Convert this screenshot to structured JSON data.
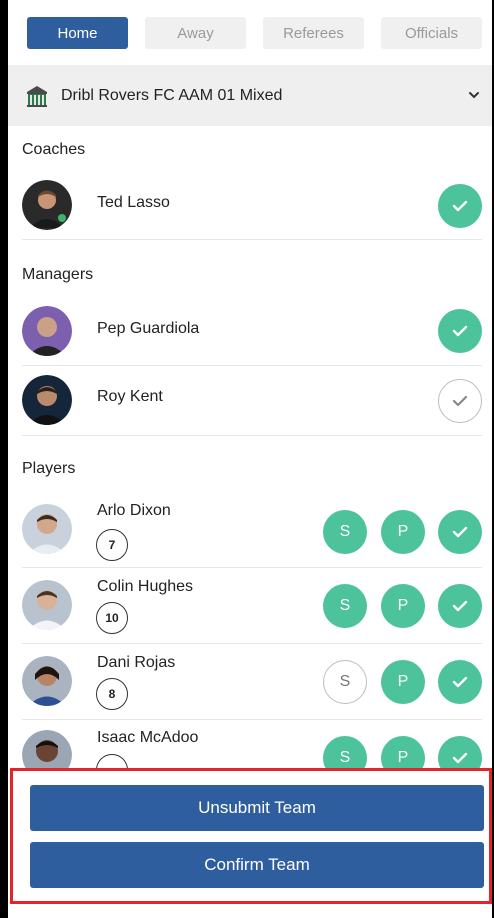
{
  "tabs": [
    {
      "label": "Home",
      "active": true
    },
    {
      "label": "Away",
      "active": false
    },
    {
      "label": "Referees",
      "active": false
    },
    {
      "label": "Officials",
      "active": false
    }
  ],
  "team": {
    "name": "Dribl Rovers FC AAM 01 Mixed",
    "icon": "club-crest-icon"
  },
  "sections": {
    "coaches": "Coaches",
    "managers": "Managers",
    "players": "Players"
  },
  "coaches": [
    {
      "name": "Ted Lasso",
      "checked": true
    }
  ],
  "managers": [
    {
      "name": "Pep Guardiola",
      "checked": true
    },
    {
      "name": "Roy Kent",
      "checked": false
    }
  ],
  "players": [
    {
      "name": "Arlo Dixon",
      "number": "7",
      "s_label": "S",
      "p_label": "P",
      "s_active": true,
      "p_active": true,
      "checked": true
    },
    {
      "name": "Colin Hughes",
      "number": "10",
      "s_label": "S",
      "p_label": "P",
      "s_active": true,
      "p_active": true,
      "checked": true
    },
    {
      "name": "Dani Rojas",
      "number": "8",
      "s_label": "S",
      "p_label": "P",
      "s_active": false,
      "p_active": true,
      "checked": true
    },
    {
      "name": "Isaac McAdoo",
      "number": "",
      "s_label": "S",
      "p_label": "P",
      "s_active": true,
      "p_active": true,
      "checked": true
    }
  ],
  "actions": {
    "unsubmit": "Unsubmit Team",
    "confirm": "Confirm Team"
  },
  "colors": {
    "primary": "#2f5e9f",
    "success": "#4cc39a",
    "highlight": "#e3242b"
  }
}
